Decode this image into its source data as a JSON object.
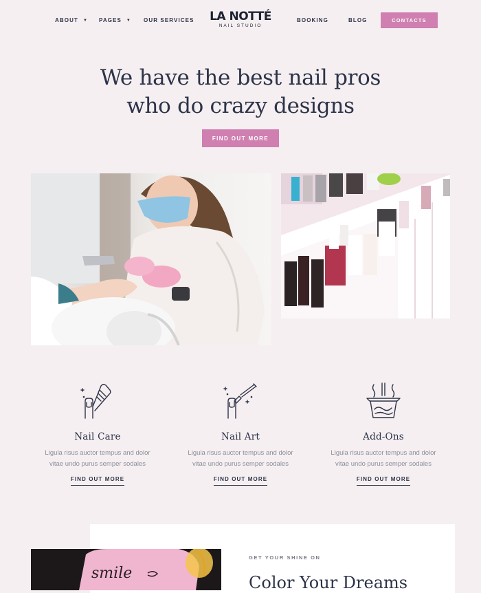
{
  "nav": {
    "about": "ABOUT",
    "pages": "PAGES",
    "services": "OUR SERVICES",
    "booking": "BOOKING",
    "blog": "BLOG",
    "contacts": "CONTACTS",
    "logo_main": "LA NOTTÉ",
    "logo_sub": "NAIL STUDIO"
  },
  "hero": {
    "title_line1": "We have the best nail pros",
    "title_line2": "who do crazy designs",
    "cta": "FIND OUT MORE"
  },
  "services": [
    {
      "title": "Nail Care",
      "desc_line1": "Ligula risus auctor tempus and dolor",
      "desc_line2": "vitae undo purus semper sodales",
      "link": "FIND OUT MORE",
      "icon": "nail-file-icon"
    },
    {
      "title": "Nail Art",
      "desc_line1": "Ligula risus auctor tempus and dolor",
      "desc_line2": "vitae undo purus semper sodales",
      "link": "FIND OUT MORE",
      "icon": "nail-brush-icon"
    },
    {
      "title": "Add-Ons",
      "desc_line1": "Ligula risus auctor tempus and dolor",
      "desc_line2": "vitae undo purus semper sodales",
      "link": "FIND OUT MORE",
      "icon": "soak-bowl-icon"
    }
  ],
  "bottom": {
    "eyebrow": "GET YOUR SHINE ON",
    "title": "Color Your Dreams",
    "photo_text": "smile"
  },
  "colors": {
    "accent": "#cf7fb0",
    "background": "#f5eff1",
    "text": "#2e3346"
  }
}
